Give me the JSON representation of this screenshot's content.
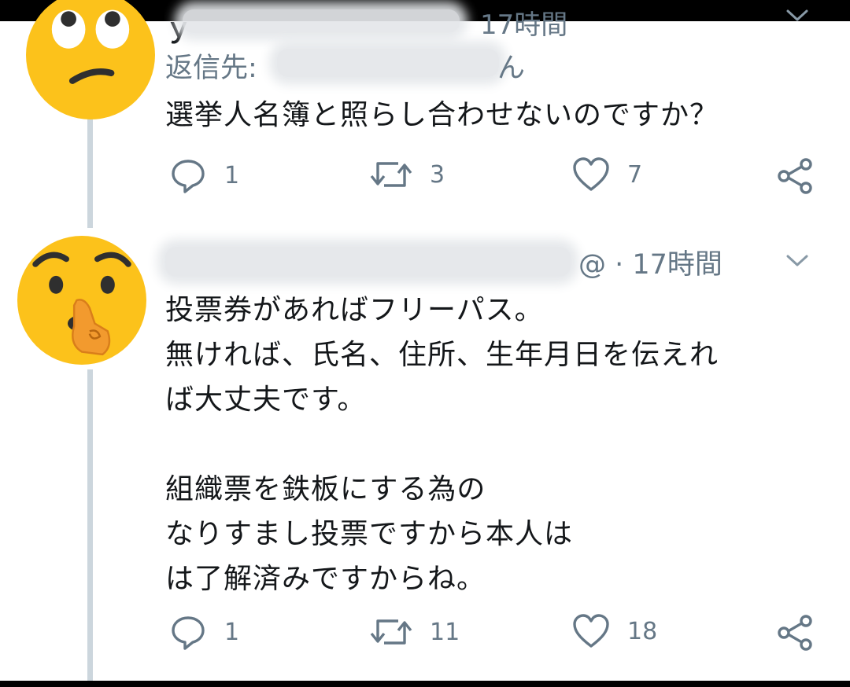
{
  "tweets": [
    {
      "time": "17時間",
      "reply_prefix": "返信先:",
      "reply_suffix": "ん",
      "text": "選挙人名簿と照らし合わせないのですか？",
      "stats": {
        "replies": "1",
        "retweets": "3",
        "likes": "7"
      },
      "avatar": "face-with-rolling-eyes-emoji"
    },
    {
      "handle_suffix": "@",
      "time": "· 17時間",
      "text_lines": [
        "投票券があればフリーパス。",
        "無ければ、氏名、住所、生年月日を伝えれ",
        "ば大丈夫です。",
        "",
        "組織票を鉄板にする為の",
        "なりすまし投票ですから本人は",
        "は了解済みですからね。"
      ],
      "stats": {
        "replies": "1",
        "retweets": "11",
        "likes": "18"
      },
      "avatar": "shushing-face-emoji"
    }
  ],
  "icons": {
    "reply": "reply-icon",
    "retweet": "retweet-icon",
    "like": "heart-icon",
    "share": "share-icon",
    "menu": "chevron-down-icon"
  },
  "colors": {
    "text": "#14171a",
    "muted": "#657786",
    "thread_line": "#ccd6dd",
    "emoji_face": "#fcc21b"
  }
}
